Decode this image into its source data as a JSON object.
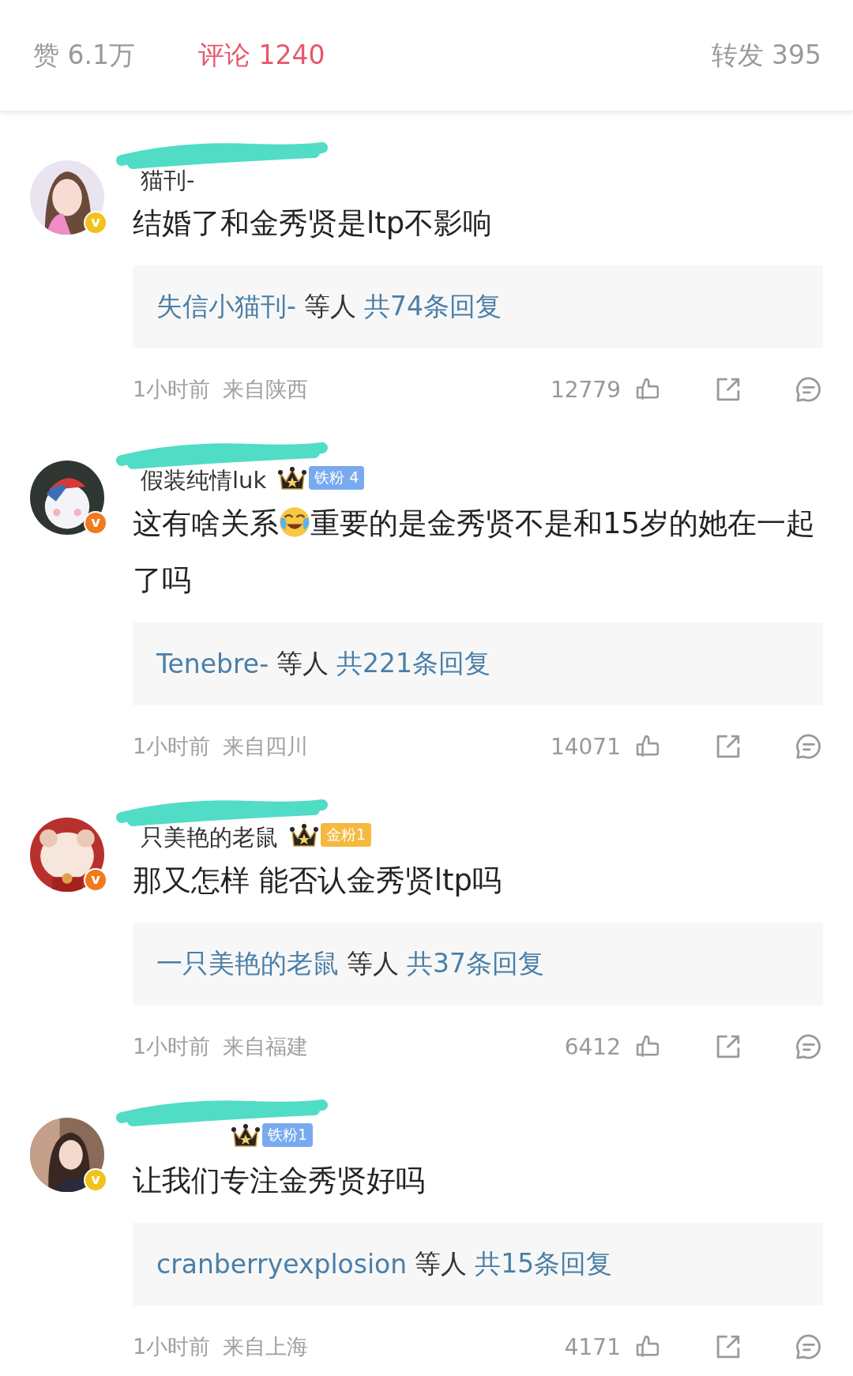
{
  "tabs": [
    {
      "label": "赞 6.1万",
      "selected": false
    },
    {
      "label": "评论 1240",
      "selected": true
    },
    {
      "label": "转发 395",
      "selected": false
    }
  ],
  "comments": [
    {
      "name": "猫刊-",
      "verified": {
        "mark": "v",
        "color": "#f2c21b"
      },
      "text_parts": [
        {
          "kind": "text",
          "text": "结婚了和金秀贤是ltp不影响"
        }
      ],
      "reply_names": "失信小猫刊-",
      "reply_mid": "等人",
      "reply_count": "共74条回复",
      "time": "1小时前",
      "location": "来自陕西",
      "likes": "12779"
    },
    {
      "name": "假装纯情luk",
      "badge": {
        "label": "铁粉 4",
        "color": "#79aaf0"
      },
      "verified": {
        "mark": "v",
        "color": "#f07a1e"
      },
      "text_parts": [
        {
          "kind": "text",
          "text": "这有啥关系"
        },
        {
          "kind": "emoji"
        },
        {
          "kind": "text",
          "text": "重要的是金秀贤不是和15岁的她在一起了吗"
        }
      ],
      "reply_names": "Tenebre-",
      "reply_mid": "等人",
      "reply_count": "共221条回复",
      "time": "1小时前",
      "location": "来自四川",
      "likes": "14071"
    },
    {
      "name": "只美艳的老鼠",
      "badge": {
        "label": "金粉1",
        "color": "#f5b940"
      },
      "verified": {
        "mark": "v",
        "color": "#f07a1e"
      },
      "text_parts": [
        {
          "kind": "text",
          "text": "那又怎样 能否认金秀贤ltp吗"
        }
      ],
      "reply_names": "一只美艳的老鼠",
      "reply_mid": "等人",
      "reply_count": "共37条回复",
      "time": "1小时前",
      "location": "来自福建",
      "likes": "6412"
    },
    {
      "badge": {
        "label": "铁粉1",
        "color": "#79aaf0"
      },
      "verified": {
        "mark": "v",
        "color": "#f2c21b"
      },
      "text_parts": [
        {
          "kind": "text",
          "text": "让我们专注金秀贤好吗"
        }
      ],
      "reply_names": "cranberryexplosion",
      "reply_mid": "等人",
      "reply_count": "共15条回复",
      "time": "1小时前",
      "location": "来自上海",
      "likes": "4171"
    }
  ]
}
